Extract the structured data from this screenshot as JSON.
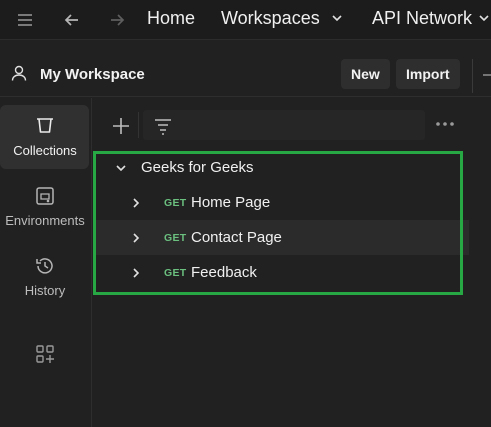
{
  "topbar": {
    "home_label": "Home",
    "workspaces_label": "Workspaces",
    "api_network_label": "API Network"
  },
  "workspace": {
    "title": "My Workspace",
    "new_label": "New",
    "import_label": "Import"
  },
  "nav": {
    "items": [
      {
        "label": "Collections",
        "icon": "collections-icon",
        "active": true
      },
      {
        "label": "Environments",
        "icon": "environments-icon",
        "active": false
      },
      {
        "label": "History",
        "icon": "history-icon",
        "active": false
      }
    ]
  },
  "tree": {
    "collection_name": "Geeks for Geeks",
    "requests": [
      {
        "method": "GET",
        "name": "Home Page"
      },
      {
        "method": "GET",
        "name": "Contact Page"
      },
      {
        "method": "GET",
        "name": "Feedback"
      }
    ]
  },
  "colors": {
    "background": "#212121",
    "get_method": "#6bbf7f",
    "highlight_border": "#28a745"
  }
}
